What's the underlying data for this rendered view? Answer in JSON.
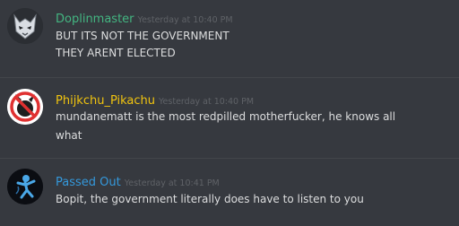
{
  "messages": [
    {
      "username": "Doplinmaster",
      "username_color": "#43b581",
      "timestamp": "Yesterday at 10:40 PM",
      "avatar_icon": "wolf-mask-avatar",
      "lines": [
        "BUT ITS NOT THE GOVERNMENT",
        "THEY ARENT ELECTED"
      ]
    },
    {
      "username": "Phijkchu_Pikachu",
      "username_color": "#f1c40f",
      "timestamp": "Yesterday at 10:40 PM",
      "avatar_icon": "pikachu-prohibited-avatar",
      "lines": [
        "mundanematt is the most redpilled motherfucker, he knows all",
        "what"
      ]
    },
    {
      "username": "Passed Out",
      "username_color": "#3498db",
      "timestamp": "Yesterday at 10:41 PM",
      "avatar_icon": "blue-figure-avatar",
      "lines": [
        "Bopit, the government literally does have to listen to you"
      ]
    }
  ]
}
